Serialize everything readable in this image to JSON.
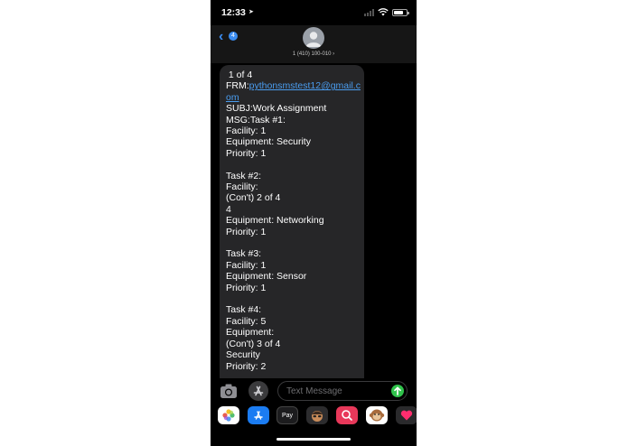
{
  "status_bar": {
    "time": "12:33"
  },
  "header": {
    "unread_count": "4",
    "contact": "1 (410) 100-010 ›"
  },
  "message": {
    "lines": [
      " 1 of 4",
      {
        "prefix": "FRM:",
        "link": "pythonsmstest12@gmail.c"
      },
      {
        "prefix": "",
        "link": "om"
      },
      "SUBJ:Work Assignment",
      "MSG:Task #1:",
      "Facility: 1",
      "Equipment: Security",
      "Priority: 1",
      "",
      "Task #2:",
      "Facility:",
      "(Con't) 2 of 4",
      "4",
      "Equipment: Networking",
      "Priority: 1",
      "",
      "Task #3:",
      "Facility: 1",
      "Equipment: Sensor",
      "Priority: 1",
      "",
      "Task #4:",
      "Facility: 5",
      "Equipment:",
      "(Con't) 3 of 4",
      "Security",
      "Priority: 2"
    ]
  },
  "input": {
    "placeholder": "Text Message"
  },
  "apps": [
    {
      "name": "photos-app-icon",
      "label": ""
    },
    {
      "name": "appstore-app-icon",
      "label": ""
    },
    {
      "name": "applepay-app-icon",
      "label": "Pay"
    },
    {
      "name": "memoji-app-icon",
      "label": ""
    },
    {
      "name": "images-search-app-icon",
      "label": ""
    },
    {
      "name": "animoji-app-icon",
      "label": ""
    },
    {
      "name": "digital-touch-app-icon",
      "label": ""
    }
  ],
  "colors": {
    "accent": "#3b8cf0",
    "send": "#30c24b",
    "bubble": "#262628"
  }
}
